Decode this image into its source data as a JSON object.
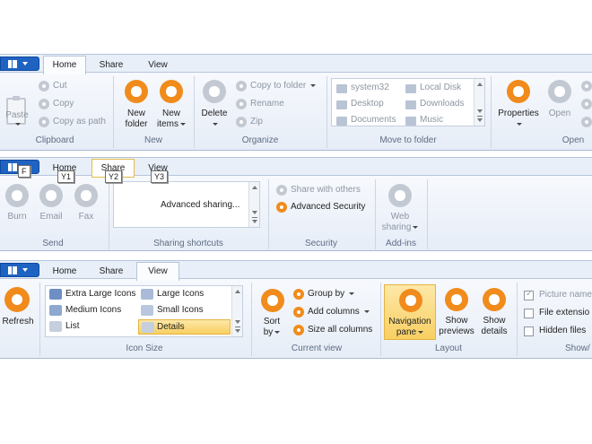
{
  "tabs": {
    "home": "Home",
    "share": "Share",
    "view": "View"
  },
  "home": {
    "clipboard": {
      "paste": "Paste",
      "cut": "Cut",
      "copy": "Copy",
      "copy_as_path": "Copy as path",
      "group": "Clipboard"
    },
    "new": {
      "new_folder": [
        "New",
        "folder"
      ],
      "new_items": [
        "New",
        "items"
      ],
      "group": "New"
    },
    "organize": {
      "delete": "Delete",
      "copy_to_folder": "Copy to folder",
      "rename": "Rename",
      "zip": "Zip",
      "group": "Organize"
    },
    "move_to": {
      "system32": "system32",
      "desktop": "Desktop",
      "documents": "Documents",
      "local_disk": "Local Disk",
      "downloads": "Downloads",
      "music": "Music",
      "group": "Move to folder"
    },
    "open": {
      "properties": "Properties",
      "open": "Open",
      "group": "Open"
    }
  },
  "share": {
    "keytips": {
      "file": "F",
      "home": "Y1",
      "share": "Y2",
      "view": "Y3"
    },
    "send": {
      "burn": "Burn",
      "email": "Email",
      "fax": "Fax",
      "group": "Send"
    },
    "sharing_shortcuts": {
      "advanced_sharing": "Advanced sharing...",
      "group": "Sharing shortcuts"
    },
    "security": {
      "share_with_others": "Share with others",
      "advanced_security": "Advanced Security",
      "group": "Security"
    },
    "addins": {
      "web_sharing": [
        "Web",
        "sharing"
      ],
      "group": "Add-ins"
    }
  },
  "view": {
    "refresh": "Refresh",
    "icon_size": {
      "extra_large": "Extra Large Icons",
      "large": "Large Icons",
      "medium": "Medium Icons",
      "small": "Small Icons",
      "list": "List",
      "details": "Details",
      "group": "Icon Size"
    },
    "current_view": {
      "sort_by": [
        "Sort",
        "by"
      ],
      "group_by": "Group by",
      "add_columns": "Add columns",
      "size_all_columns": "Size all columns",
      "group": "Current view"
    },
    "layout": {
      "navigation_pane": [
        "Navigation",
        "pane"
      ],
      "show_previews": [
        "Show",
        "previews"
      ],
      "show_details": [
        "Show",
        "details"
      ],
      "group": "Layout"
    },
    "show_hide": {
      "picture_names": "Picture name",
      "file_extensions": "File extensio",
      "hidden_files": "Hidden files",
      "group": "Show/"
    }
  },
  "colors": {
    "accent_orange": "#f08b1c",
    "disabled_gray": "#c3c9d2",
    "file_button_blue": "#1f63c2",
    "selection_gold": "#f8cf62"
  }
}
